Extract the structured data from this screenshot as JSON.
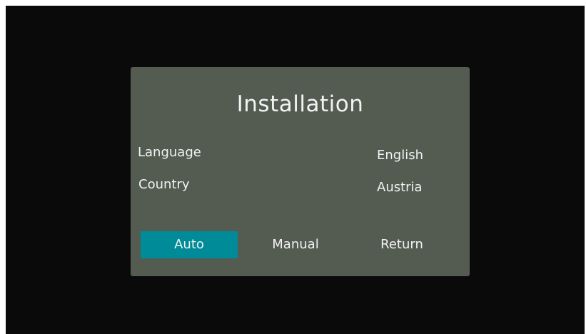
{
  "dialog": {
    "title": "Installation",
    "settings": [
      {
        "label": "Language",
        "value": "English"
      },
      {
        "label": "Country",
        "value": "Austria"
      }
    ],
    "buttons": {
      "auto": "Auto",
      "manual": "Manual",
      "return": "Return"
    },
    "selected_button": "Auto"
  },
  "colors": {
    "screen_background": "#0a0a0a",
    "dialog_background": "#545c52",
    "selected_highlight": "#008b99",
    "text": "#f2f2f2"
  }
}
